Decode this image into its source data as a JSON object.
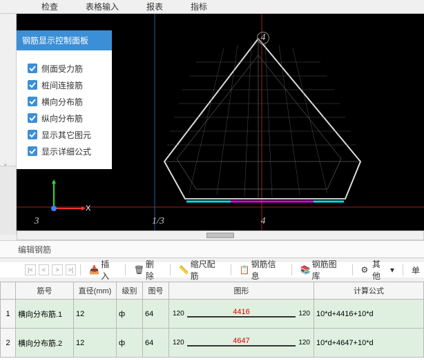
{
  "top_tabs": [
    "检查",
    "表格输入",
    "报表",
    "指标"
  ],
  "panel": {
    "title": "钢筋显示控制面板",
    "options": [
      "侧面受力筋",
      "桩间连接筋",
      "横向分布筋",
      "纵向分布筋",
      "显示其它图元",
      "显示详细公式"
    ]
  },
  "viewport": {
    "x_axis": "X",
    "labels": {
      "top4": "4",
      "bl3": "3",
      "bl13": "1/3",
      "b4": "4"
    }
  },
  "section_header": "编辑钢筋",
  "toolbar": {
    "nav": [
      "|<",
      "<",
      ">",
      ">|"
    ],
    "insert": "插入",
    "delete": "删除",
    "scale": "缩尺配筋",
    "info": "钢筋信息",
    "lib": "钢筋图库",
    "other": "其他",
    "single": "单"
  },
  "table": {
    "columns": [
      "筋号",
      "直径(mm)",
      "级别",
      "图号",
      "图形",
      "计算公式"
    ],
    "rows": [
      {
        "idx": "1",
        "name": "横向分布筋.1",
        "dia": "12",
        "lvl": "ф",
        "code": "64",
        "edgeL": "120",
        "mid": "4416",
        "edgeR": "120",
        "formula": "10*d+4416+10*d"
      },
      {
        "idx": "2",
        "name": "横向分布筋.2",
        "dia": "12",
        "lvl": "ф",
        "code": "64",
        "edgeL": "120",
        "mid": "4647",
        "edgeR": "120",
        "formula": "10*d+4647+10*d"
      }
    ]
  }
}
